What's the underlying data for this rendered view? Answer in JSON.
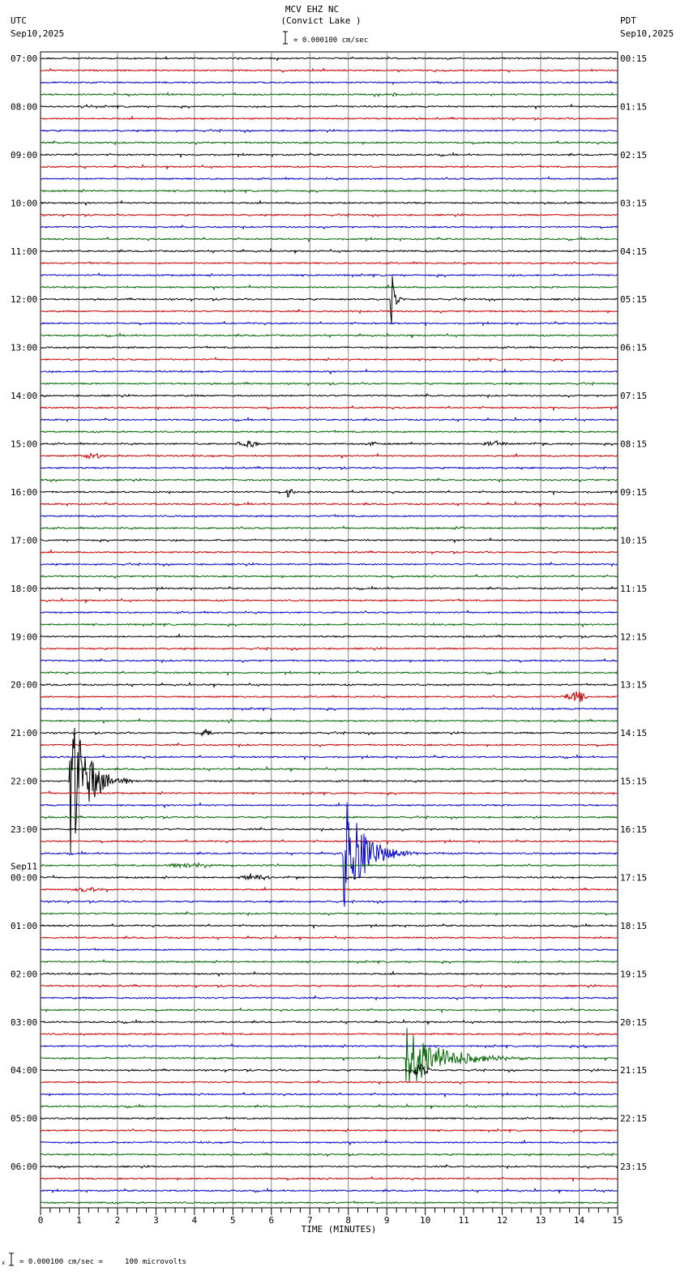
{
  "header": {
    "title": "MCV EHZ NC",
    "subtitle": "(Convict Lake )",
    "scale_label": "= 0.000100 cm/sec",
    "left_tz": "UTC",
    "left_date": "Sep10,2025",
    "right_tz": "PDT",
    "right_date": "Sep10,2025"
  },
  "footer": {
    "scale_note": "= 0.000100 cm/sec =     100 microvolts",
    "scale_prefix": "x"
  },
  "chart_data": {
    "type": "line",
    "title": "MCV EHZ NC (Convict Lake )",
    "xlabel": "TIME (MINUTES)",
    "xlim": [
      0,
      15
    ],
    "x_ticks": [
      "0",
      "1",
      "2",
      "3",
      "4",
      "5",
      "6",
      "7",
      "8",
      "9",
      "10",
      "11",
      "12",
      "13",
      "14",
      "15"
    ],
    "minutes_per_row": 15,
    "row_count": 96,
    "trace_colors": [
      "#000000",
      "#cc0000",
      "#0000cc",
      "#006600"
    ],
    "grid_color": "#888888",
    "left_hour_labels": [
      "07:00",
      "08:00",
      "09:00",
      "10:00",
      "11:00",
      "12:00",
      "13:00",
      "14:00",
      "15:00",
      "16:00",
      "17:00",
      "18:00",
      "19:00",
      "20:00",
      "21:00",
      "22:00",
      "23:00",
      "00:00",
      "01:00",
      "02:00",
      "03:00",
      "04:00",
      "05:00",
      "06:00"
    ],
    "date_change_label": "Sep11",
    "right_hour_labels": [
      "00:15",
      "01:15",
      "02:15",
      "03:15",
      "04:15",
      "05:15",
      "06:15",
      "07:15",
      "08:15",
      "09:15",
      "10:15",
      "11:15",
      "12:15",
      "13:15",
      "14:15",
      "15:15",
      "16:15",
      "17:15",
      "18:15",
      "19:15",
      "20:15",
      "21:15",
      "22:15",
      "23:15"
    ],
    "events": [
      {
        "row": 3,
        "minute": 9.1,
        "amp": 0.15,
        "duration": 0.2,
        "kind": "blip"
      },
      {
        "row": 20,
        "minute": 9.1,
        "amp": 2.2,
        "duration": 0.3,
        "kind": "spike",
        "bias": 1.0
      },
      {
        "row": 32,
        "minute": 5.0,
        "amp": 0.25,
        "duration": 0.8,
        "kind": "burst"
      },
      {
        "row": 32,
        "minute": 8.4,
        "amp": 0.15,
        "duration": 0.4,
        "kind": "burst"
      },
      {
        "row": 32,
        "minute": 11.4,
        "amp": 0.2,
        "duration": 0.9,
        "kind": "burst"
      },
      {
        "row": 33,
        "minute": 0.8,
        "amp": 0.2,
        "duration": 1.0,
        "kind": "burst"
      },
      {
        "row": 36,
        "minute": 6.4,
        "amp": 0.6,
        "duration": 0.3,
        "kind": "spike",
        "bias": -0.3
      },
      {
        "row": 39,
        "minute": 10.9,
        "amp": 0.2,
        "duration": 0.1,
        "kind": "blip"
      },
      {
        "row": 53,
        "minute": 13.5,
        "amp": 0.45,
        "duration": 0.8,
        "kind": "burst"
      },
      {
        "row": 55,
        "minute": 4.8,
        "amp": 0.2,
        "duration": 0.2,
        "kind": "blip"
      },
      {
        "row": 56,
        "minute": 4.1,
        "amp": 0.3,
        "duration": 0.4,
        "kind": "burst"
      },
      {
        "row": 60,
        "minute": 0.75,
        "amp": 6.8,
        "duration": 1.2,
        "kind": "quake",
        "bias": -2.0
      },
      {
        "row": 66,
        "minute": 7.85,
        "amp": 5.6,
        "duration": 1.4,
        "kind": "quake",
        "bias": -1.2
      },
      {
        "row": 67,
        "minute": 3.0,
        "amp": 0.2,
        "duration": 1.8,
        "kind": "burst"
      },
      {
        "row": 68,
        "minute": 5.0,
        "amp": 0.25,
        "duration": 1.2,
        "kind": "burst"
      },
      {
        "row": 69,
        "minute": 0.8,
        "amp": 0.2,
        "duration": 0.9,
        "kind": "burst"
      },
      {
        "row": 82,
        "minute": 14.1,
        "amp": 0.25,
        "duration": 0.1,
        "kind": "blip"
      },
      {
        "row": 83,
        "minute": 9.5,
        "amp": 2.6,
        "duration": 2.5,
        "kind": "quake",
        "bias": 0
      },
      {
        "row": 84,
        "minute": 9.5,
        "amp": 0.5,
        "duration": 0.7,
        "kind": "burst"
      }
    ]
  }
}
